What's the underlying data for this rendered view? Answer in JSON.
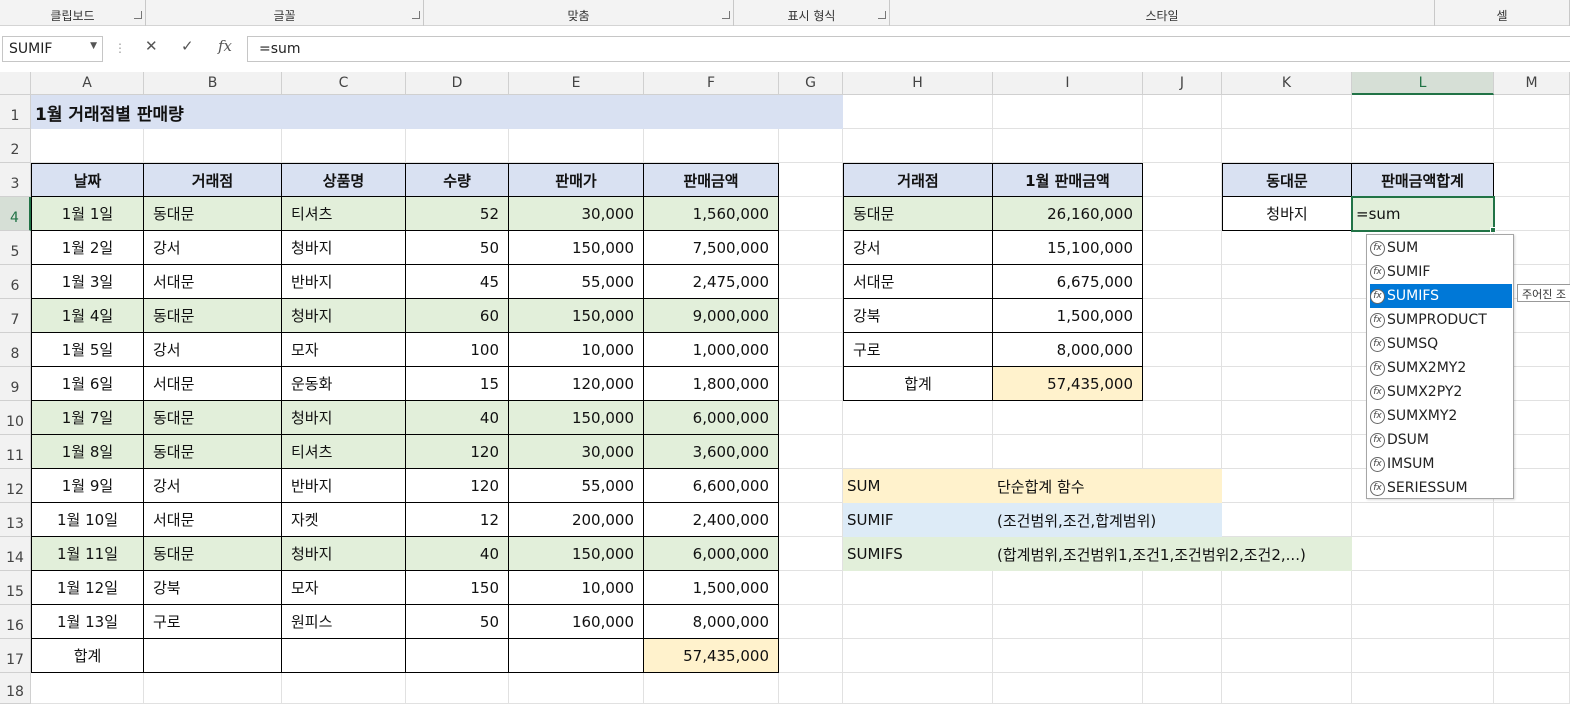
{
  "ribbon": {
    "groups": [
      "클립보드",
      "글꼴",
      "맞춤",
      "표시 형식",
      "스타일",
      "셀"
    ]
  },
  "formula_bar": {
    "name_box": "SUMIF",
    "cancel_icon": "✕",
    "enter_icon": "✓",
    "fx_label": "fx",
    "formula": "=sum"
  },
  "columns": [
    "A",
    "B",
    "C",
    "D",
    "E",
    "F",
    "G",
    "H",
    "I",
    "J",
    "K",
    "L",
    "M"
  ],
  "rows": [
    "1",
    "2",
    "3",
    "4",
    "5",
    "6",
    "7",
    "8",
    "9",
    "10",
    "11",
    "12",
    "13",
    "14",
    "15",
    "16",
    "17",
    "18"
  ],
  "title": "1월 거래점별 판매량",
  "main_table": {
    "headers": [
      "날짜",
      "거래점",
      "상품명",
      "수량",
      "판매가",
      "판매금액"
    ],
    "rows": [
      [
        "1월 1일",
        "동대문",
        "티셔츠",
        "52",
        "30,000",
        "1,560,000"
      ],
      [
        "1월 2일",
        "강서",
        "청바지",
        "50",
        "150,000",
        "7,500,000"
      ],
      [
        "1월 3일",
        "서대문",
        "반바지",
        "45",
        "55,000",
        "2,475,000"
      ],
      [
        "1월 4일",
        "동대문",
        "청바지",
        "60",
        "150,000",
        "9,000,000"
      ],
      [
        "1월 5일",
        "강서",
        "모자",
        "100",
        "10,000",
        "1,000,000"
      ],
      [
        "1월 6일",
        "서대문",
        "운동화",
        "15",
        "120,000",
        "1,800,000"
      ],
      [
        "1월 7일",
        "동대문",
        "청바지",
        "40",
        "150,000",
        "6,000,000"
      ],
      [
        "1월 8일",
        "동대문",
        "티셔츠",
        "120",
        "30,000",
        "3,600,000"
      ],
      [
        "1월 9일",
        "강서",
        "반바지",
        "120",
        "55,000",
        "6,600,000"
      ],
      [
        "1월 10일",
        "서대문",
        "자켓",
        "12",
        "200,000",
        "2,400,000"
      ],
      [
        "1월 11일",
        "동대문",
        "청바지",
        "40",
        "150,000",
        "6,000,000"
      ],
      [
        "1월 12일",
        "강북",
        "모자",
        "150",
        "10,000",
        "1,500,000"
      ],
      [
        "1월 13일",
        "구로",
        "원피스",
        "50",
        "160,000",
        "8,000,000"
      ]
    ],
    "total_label": "합계",
    "total_value": "57,435,000"
  },
  "summary_table": {
    "headers": [
      "거래점",
      "1월 판매금액"
    ],
    "rows": [
      [
        "동대문",
        "26,160,000"
      ],
      [
        "강서",
        "15,100,000"
      ],
      [
        "서대문",
        "6,675,000"
      ],
      [
        "강북",
        "1,500,000"
      ],
      [
        "구로",
        "8,000,000"
      ]
    ],
    "total_label": "합계",
    "total_value": "57,435,000"
  },
  "criteria_table": {
    "headers": [
      "동대문",
      "판매금액합계"
    ],
    "row": [
      "청바지",
      "=sum"
    ]
  },
  "notes": [
    {
      "name": "SUM",
      "desc": "단순합계 함수"
    },
    {
      "name": "SUMIF",
      "desc": "(조건범위,조건,합계범위)"
    },
    {
      "name": "SUMIFS",
      "desc": "(합계범위,조건범위1,조건1,조건범위2,조건2,...)"
    }
  ],
  "autocomplete": {
    "items": [
      "SUM",
      "SUMIF",
      "SUMIFS",
      "SUMPRODUCT",
      "SUMSQ",
      "SUMX2MY2",
      "SUMX2PY2",
      "SUMXMY2",
      "DSUM",
      "IMSUM",
      "SERIESSUM"
    ],
    "selected_index": 2,
    "tooltip": "주어진 조"
  },
  "colors": {
    "header_fill": "#d9e1f2",
    "highlight_row_fill": "#e2efda",
    "total_fill": "#fff2cc",
    "note_sumif_fill": "#ddebf7",
    "selection": "#217346",
    "autocomplete_selected": "#0078d7"
  }
}
